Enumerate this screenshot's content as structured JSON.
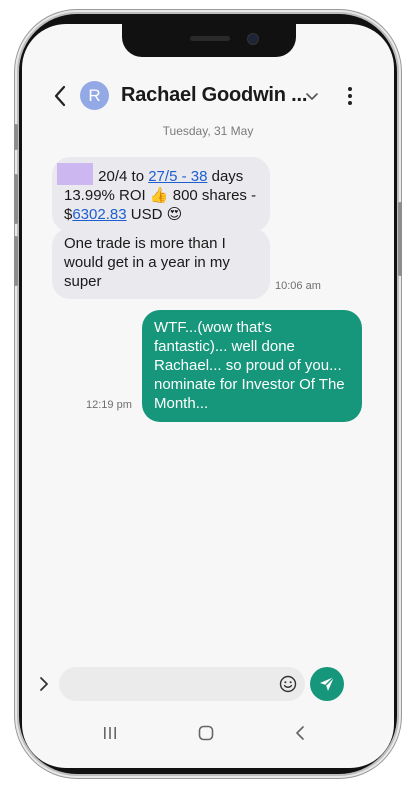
{
  "header": {
    "avatar_letter": "R",
    "contact_name": "Rachael Goodwin ..."
  },
  "date_separator": "Tuesday, 31 May",
  "messages": [
    {
      "direction": "incoming",
      "segments": [
        {
          "text": " 20/4 to ",
          "link": false
        },
        {
          "text": "27/5 - 38",
          "link": true
        },
        {
          "text": " days",
          "link": false
        }
      ],
      "line2": "13.99% ROI 👍 800 shares -",
      "line3_prefix": "$",
      "line3_link": "6302.83",
      "line3_suffix": " USD 😍",
      "has_redaction": true
    },
    {
      "direction": "incoming",
      "text": "One trade is more than I would get in a year in my super",
      "time": "10:06 am"
    },
    {
      "direction": "outgoing",
      "text": "WTF...(wow that's fantastic)... well done Rachael... so proud of you... nominate for Investor Of The Month...",
      "time": "12:19 pm"
    }
  ],
  "composer": {
    "placeholder": "",
    "value": ""
  },
  "icons": {
    "back": "chevron-left-icon",
    "expand": "chevron-down-icon",
    "menu": "more-vertical-icon",
    "attach": "chevron-right-icon",
    "emoji": "emoji-icon",
    "send": "send-icon",
    "nav_recents": "recents-icon",
    "nav_home": "home-icon",
    "nav_back": "nav-back-icon"
  },
  "colors": {
    "outgoing_bubble": "#16967a",
    "incoming_bubble": "#e9e9ee",
    "avatar": "#93a9e6",
    "link": "#1d5fd1",
    "redaction": "#cdb7f0"
  }
}
